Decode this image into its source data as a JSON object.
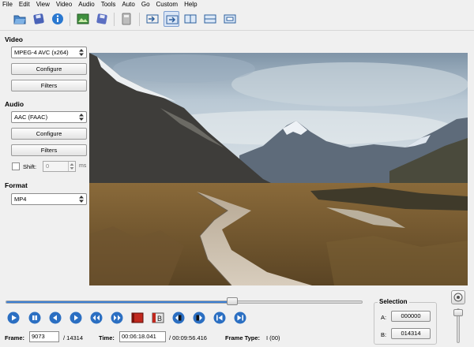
{
  "menu": [
    "File",
    "Edit",
    "View",
    "Video",
    "Audio",
    "Tools",
    "Auto",
    "Go",
    "Custom",
    "Help"
  ],
  "toolbar": {
    "icons": [
      "open-video-icon",
      "save-video-icon",
      "info-icon",
      "open-image-icon",
      "save-image-icon",
      "calculator-icon",
      "input-mode-icon",
      "output-mode-icon",
      "side-by-side-icon",
      "top-bottom-icon",
      "display-mode-icon"
    ]
  },
  "video": {
    "section": "Video",
    "codec": "MPEG-4 AVC (x264)",
    "configure": "Configure",
    "filters": "Filters"
  },
  "audio": {
    "section": "Audio",
    "codec": "AAC (FAAC)",
    "configure": "Configure",
    "filters": "Filters",
    "shift_label": "Shift:",
    "shift_value": "0",
    "shift_unit": "ms"
  },
  "format": {
    "section": "Format",
    "value": "MP4"
  },
  "timeline": {
    "position_fraction": 0.634
  },
  "status": {
    "frame_label": "Frame:",
    "frame_value": "9073",
    "frame_total": "/ 14314",
    "time_label": "Time:",
    "time_value": "00:06:18.041",
    "time_total": "/ 00:09:56.416",
    "frame_type_label": "Frame Type:",
    "frame_type_value": "I (00)"
  },
  "selection": {
    "title": "Selection",
    "a_label": "A:",
    "a_value": "000000",
    "b_label": "B:",
    "b_value": "014314"
  },
  "playback_icons": [
    "play-icon",
    "stop-icon",
    "previous-frame-icon",
    "next-frame-icon",
    "previous-keyframe-icon",
    "next-keyframe-icon",
    "set-marker-a-icon",
    "set-marker-b-icon",
    "previous-black-frame-icon",
    "next-black-frame-icon",
    "go-to-start-icon",
    "go-to-end-icon"
  ],
  "colors": {
    "accent_blue": "#3b7fd4",
    "toolbar_active": "#dbe6f6"
  }
}
